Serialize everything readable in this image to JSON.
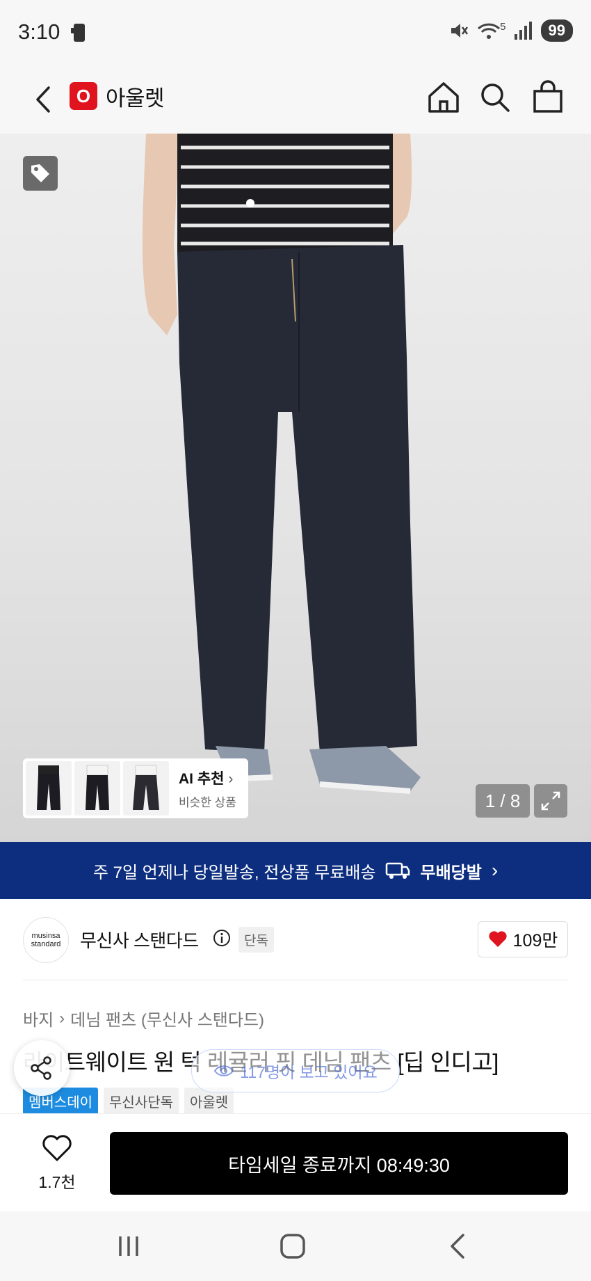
{
  "status_bar": {
    "time": "3:10",
    "battery": "99",
    "network_label": "5"
  },
  "header": {
    "logo_letter": "O",
    "title": "아울렛"
  },
  "product_image": {
    "pager": "1 / 8",
    "ai_recommend": {
      "title": "AI 추천",
      "subtitle": "비슷한 상품"
    }
  },
  "delivery_banner": {
    "text": "주 7일 언제나 당일발송, 전상품 무료배송",
    "brand": "무배당발"
  },
  "brand": {
    "logo_line1": "musinsa",
    "logo_line2": "standard",
    "name": "무신사 스탠다드",
    "badge": "단독",
    "likes": "109만",
    "heart_color": "#e0141e"
  },
  "breadcrumb": {
    "category": "바지",
    "subcategory": "데님 팬츠 (무신사 스탠다드)"
  },
  "product": {
    "title": "라이트웨이트 원 턱 레귤러 핏 데님 팬츠 [딥 인디고]",
    "tags": [
      "멤버스데이",
      "무신사단독",
      "아울렛"
    ],
    "viewers": "117명이 보고 있어요"
  },
  "bottom_bar": {
    "wish_count": "1.7천",
    "buy_label": "타임세일 종료까지 08:49:30"
  },
  "colors": {
    "banner": "#0d2e7f",
    "accent_red": "#e0141e",
    "tag_blue": "#1d8ce0"
  }
}
